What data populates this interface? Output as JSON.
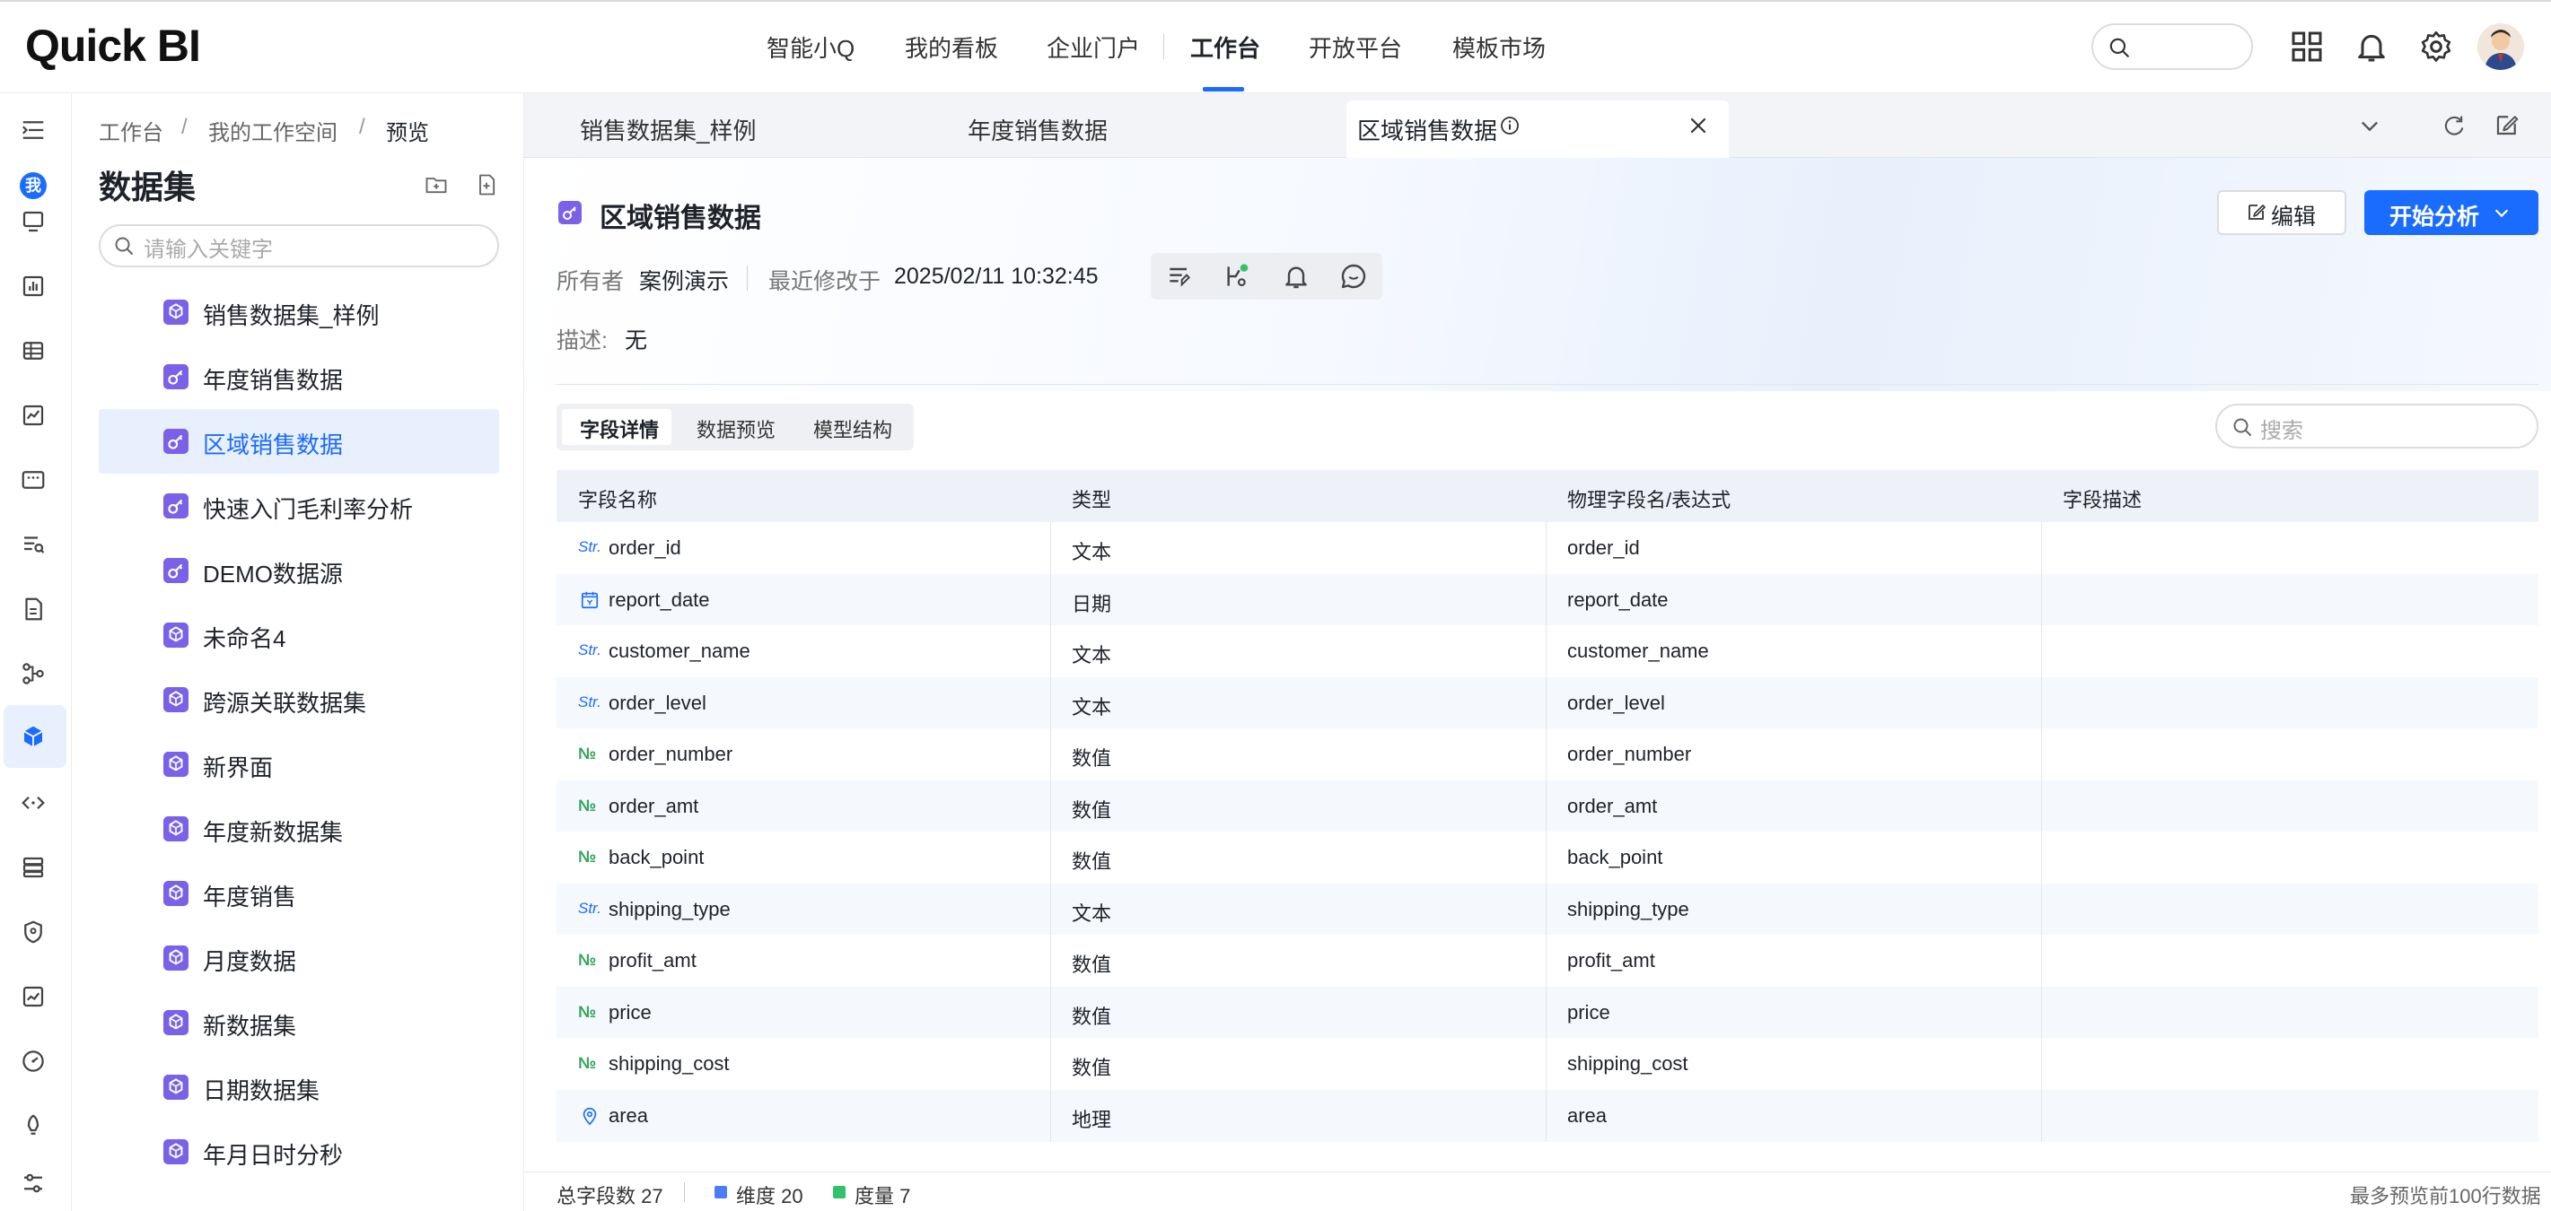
{
  "app": {
    "logo": "Quick BI"
  },
  "topnav": {
    "items": [
      "智能小Q",
      "我的看板",
      "企业门户",
      "工作台",
      "开放平台",
      "模板市场"
    ],
    "active": "工作台"
  },
  "icons": {
    "top": [
      "search-icon",
      "apps-grid-icon",
      "bell-icon",
      "gear-icon",
      "avatar"
    ],
    "rail": [
      "menu-collapse-icon",
      "monitor-icon",
      "bar-chart-icon",
      "table-icon",
      "line-chart-icon",
      "dashboard-icon",
      "query-icon",
      "document-icon",
      "flow-icon",
      "cube-icon",
      "api-icon",
      "database-icon",
      "shield-icon",
      "monitor-chart-icon",
      "gauge-icon",
      "rocket-icon",
      "settings-sliders-icon"
    ]
  },
  "rail": {
    "me_badge": "我"
  },
  "breadcrumb": [
    "工作台",
    "我的工作空间",
    "预览"
  ],
  "sidebar": {
    "title": "数据集",
    "search_placeholder": "请输入关键字",
    "items": [
      {
        "label": "销售数据集_样例",
        "kind": "cube"
      },
      {
        "label": "年度销售数据",
        "kind": "key"
      },
      {
        "label": "区域销售数据",
        "kind": "key",
        "active": true
      },
      {
        "label": "快速入门毛利率分析",
        "kind": "key"
      },
      {
        "label": "DEMO数据源",
        "kind": "key"
      },
      {
        "label": "未命名4",
        "kind": "cube"
      },
      {
        "label": "跨源关联数据集",
        "kind": "cube"
      },
      {
        "label": "新界面",
        "kind": "cube"
      },
      {
        "label": "年度新数据集",
        "kind": "cube"
      },
      {
        "label": "年度销售",
        "kind": "cube"
      },
      {
        "label": "月度数据",
        "kind": "cube"
      },
      {
        "label": "新数据集",
        "kind": "cube"
      },
      {
        "label": "日期数据集",
        "kind": "cube"
      },
      {
        "label": "年月日时分秒",
        "kind": "cube"
      }
    ]
  },
  "tabs": [
    {
      "label": "销售数据集_样例"
    },
    {
      "label": "年度销售数据"
    },
    {
      "label": "区域销售数据",
      "active": true
    }
  ],
  "page": {
    "title": "区域销售数据",
    "edit_label": "编辑",
    "analyze_label": "开始分析",
    "owner_key": "所有者",
    "owner_val": "案例演示",
    "modified_key": "最近修改于",
    "modified_val": "2025/02/11 10:32:45",
    "desc_key": "描述:",
    "desc_val": "无"
  },
  "subtabs": [
    "字段详情",
    "数据预览",
    "模型结构"
  ],
  "table_search_placeholder": "搜索",
  "table": {
    "headers": [
      "字段名称",
      "类型",
      "物理字段名/表达式",
      "字段描述"
    ],
    "rows": [
      {
        "icon": "Str.",
        "name": "order_id",
        "type": "文本",
        "physical": "order_id",
        "desc": ""
      },
      {
        "icon": "date-icon",
        "name": "report_date",
        "type": "日期",
        "physical": "report_date",
        "desc": ""
      },
      {
        "icon": "Str.",
        "name": "customer_name",
        "type": "文本",
        "physical": "customer_name",
        "desc": ""
      },
      {
        "icon": "Str.",
        "name": "order_level",
        "type": "文本",
        "physical": "order_level",
        "desc": ""
      },
      {
        "icon": "№",
        "name": "order_number",
        "type": "数值",
        "physical": "order_number",
        "desc": ""
      },
      {
        "icon": "№",
        "name": "order_amt",
        "type": "数值",
        "physical": "order_amt",
        "desc": ""
      },
      {
        "icon": "№",
        "name": "back_point",
        "type": "数值",
        "physical": "back_point",
        "desc": ""
      },
      {
        "icon": "Str.",
        "name": "shipping_type",
        "type": "文本",
        "physical": "shipping_type",
        "desc": ""
      },
      {
        "icon": "№",
        "name": "profit_amt",
        "type": "数值",
        "physical": "profit_amt",
        "desc": ""
      },
      {
        "icon": "№",
        "name": "price",
        "type": "数值",
        "physical": "price",
        "desc": ""
      },
      {
        "icon": "№",
        "name": "shipping_cost",
        "type": "数值",
        "physical": "shipping_cost",
        "desc": ""
      },
      {
        "icon": "map-pin-icon",
        "name": "area",
        "type": "地理",
        "physical": "area",
        "desc": ""
      }
    ]
  },
  "footer": {
    "total": "总字段数 27",
    "dimensions": "维度 20",
    "measures": "度量 7",
    "note": "最多预览前100行数据"
  },
  "colors": {
    "accent": "#1a6cff",
    "dataset_icon": "#7b61e8",
    "dim_square": "#4d7cf7",
    "measure_square": "#33c26b"
  }
}
